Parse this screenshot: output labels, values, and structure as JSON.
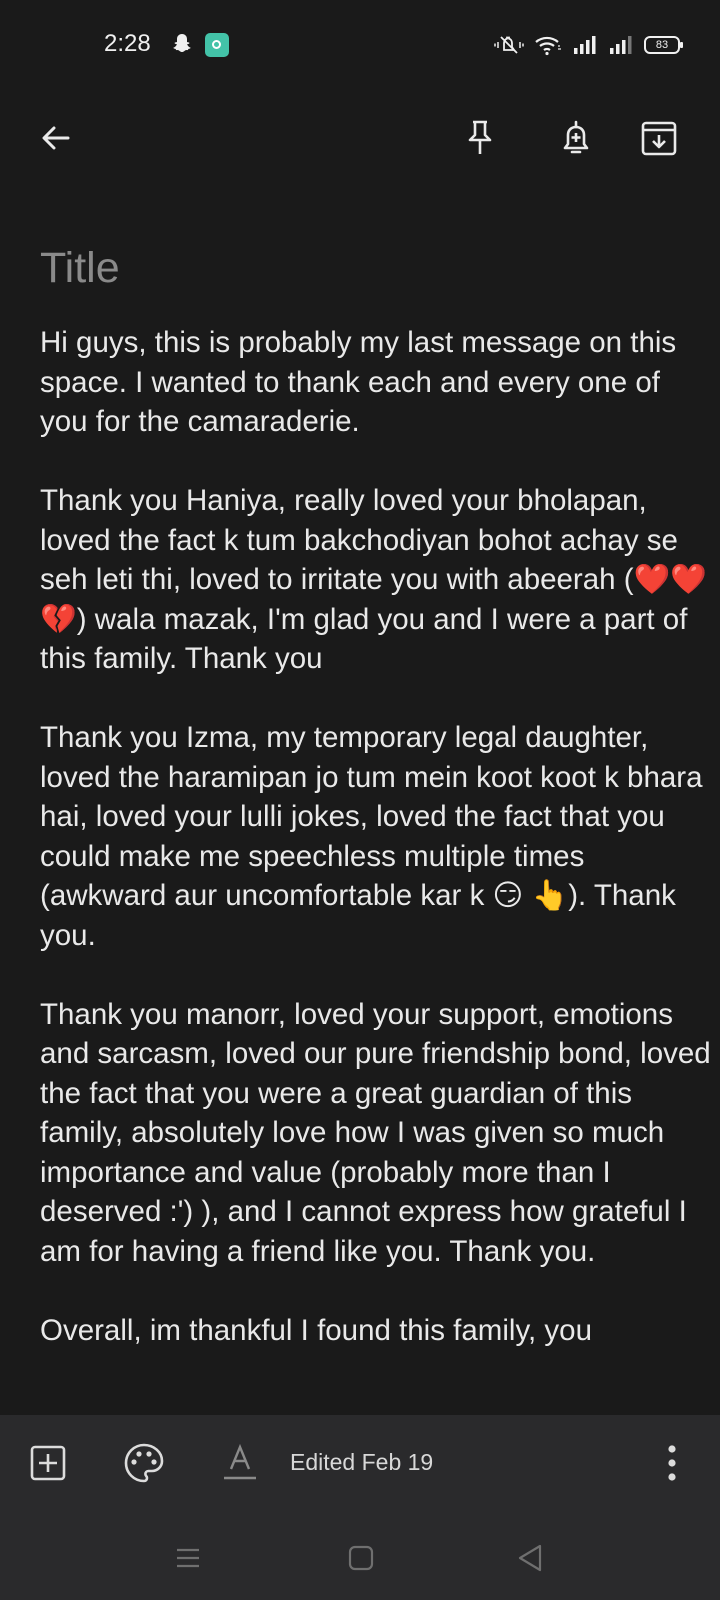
{
  "status": {
    "time": "2:28",
    "battery": "83",
    "icons": [
      "snapchat-icon",
      "app-notification-icon",
      "mute-icon",
      "wifi-icon",
      "signal-icon",
      "signal-icon",
      "battery-icon"
    ]
  },
  "toolbar": {
    "back_icon": "arrow-back-icon",
    "pin_icon": "pin-icon",
    "reminder_icon": "reminder-bell-icon",
    "archive_icon": "archive-icon"
  },
  "note": {
    "title_placeholder": "Title",
    "paragraphs": [
      "Hi guys, this is probably my last message on this space. I wanted to thank each and every one of you for the camaraderie.",
      "Thank you Haniya, really loved your bholapan, loved the fact k tum bakchodiyan bohot achay se seh leti thi, loved to irritate you with abeerah (❤️❤️💔) wala mazak, I'm glad you and I were a part of this family. Thank you",
      "Thank you Izma, my temporary legal daughter, loved the haramipan jo tum mein koot koot k bhara hai, loved your lulli jokes, loved the fact that you could make me speechless multiple times (awkward aur uncomfortable kar k 😏 👆). Thank you.",
      "Thank you manorr, loved your support, emotions and sarcasm, loved our pure friendship bond, loved the fact that you were a great guardian of this family, absolutely love how I was given so much importance and value (probably more than I deserved :') ), and I cannot express how grateful I am for having a friend like you. Thank you.",
      "Overall, im thankful I found this family, you"
    ]
  },
  "bottom_bar": {
    "add_icon": "add-box-icon",
    "palette_icon": "palette-icon",
    "text_format_icon": "text-format-icon",
    "edited_label": "Edited Feb 19",
    "more_icon": "more-vert-icon"
  },
  "nav": {
    "menu_icon": "recent-apps-icon",
    "home_icon": "home-icon",
    "back_icon": "nav-back-icon"
  },
  "colors": {
    "background": "#1a1a1a",
    "bar": "#2a2a2c",
    "text": "#e9e9e9",
    "placeholder": "#8a8a8a"
  }
}
